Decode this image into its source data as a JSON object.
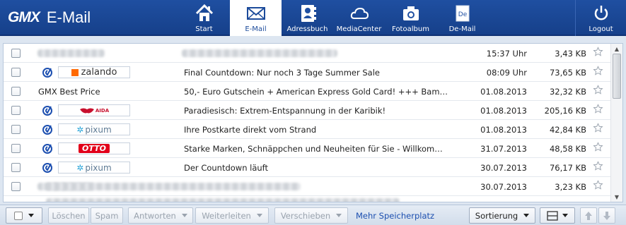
{
  "app": {
    "brand": "GMX",
    "product": "E-Mail"
  },
  "nav": [
    {
      "id": "start",
      "label": "Start",
      "icon": "home-icon"
    },
    {
      "id": "email",
      "label": "E-Mail",
      "icon": "envelope-icon",
      "active": true
    },
    {
      "id": "adressbuch",
      "label": "Adressbuch",
      "icon": "address-book-icon"
    },
    {
      "id": "mediacenter",
      "label": "MediaCenter",
      "icon": "cloud-icon"
    },
    {
      "id": "fotoalbum",
      "label": "Fotoalbum",
      "icon": "camera-icon"
    },
    {
      "id": "demail",
      "label": "De-Mail",
      "icon": "de-mail-icon"
    }
  ],
  "logout": {
    "label": "Logout",
    "icon": "power-icon"
  },
  "emails": [
    {
      "sender": "",
      "sender_blurred": true,
      "subject": "",
      "subject_blurred": true,
      "date": "15:37 Uhr",
      "size": "3,43 KB"
    },
    {
      "sender": "zalando",
      "trusted": true,
      "subject": "Final Countdown: Nur noch 3 Tage Summer Sale",
      "date": "08:09 Uhr",
      "size": "73,65 KB"
    },
    {
      "sender": "GMX Best Price",
      "subject": "50,- Euro Gutschein + American Express Gold Card! +++ Bam…",
      "date": "01.08.2013",
      "size": "32,32 KB"
    },
    {
      "sender": "AIDA",
      "trusted": true,
      "subject": "Paradiesisch: Extrem-Entspannung in der Karibik!",
      "date": "01.08.2013",
      "size": "205,16 KB"
    },
    {
      "sender": "pixum",
      "trusted": true,
      "subject": "Ihre Postkarte direkt vom Strand",
      "date": "01.08.2013",
      "size": "42,84 KB"
    },
    {
      "sender": "OTTO",
      "trusted": true,
      "subject": "Starke Marken, Schnäppchen und Neuheiten für Sie - Willkom…",
      "date": "31.07.2013",
      "size": "48,58 KB"
    },
    {
      "sender": "pixum",
      "trusted": true,
      "subject": "Der Countdown läuft",
      "date": "30.07.2013",
      "size": "76,17 KB"
    },
    {
      "sender": "",
      "sender_blurred": true,
      "subject": "",
      "subject_blurred": true,
      "date": "30.07.2013",
      "size": "3,23 KB"
    }
  ],
  "toolbar": {
    "delete": "Löschen",
    "spam": "Spam",
    "reply": "Antworten",
    "forward": "Weiterleiten",
    "move": "Verschieben",
    "storage_link": "Mehr Speicherplatz",
    "sort": "Sortierung"
  },
  "colors": {
    "header": "#1f4fa1",
    "link": "#1c4fb0",
    "toolbar": "#dde6f1"
  }
}
